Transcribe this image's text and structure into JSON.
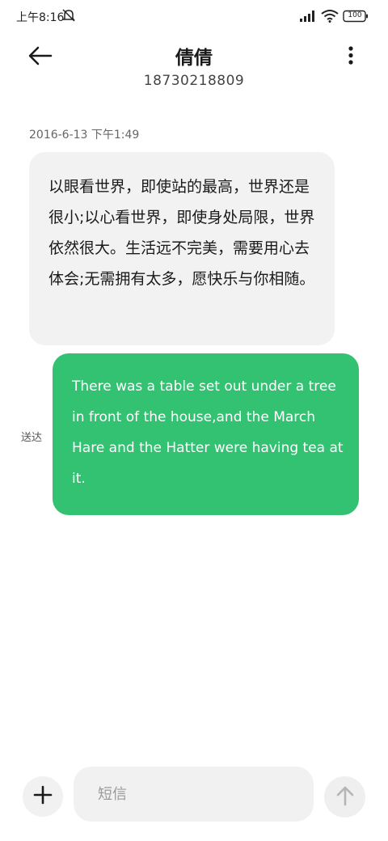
{
  "status_bar": {
    "time": "上午8:16",
    "battery": "100",
    "icons": [
      "do-not-disturb-icon",
      "signal-icon",
      "wifi-icon",
      "battery-icon"
    ]
  },
  "header": {
    "contact_name": "倩倩",
    "contact_number": "18730218809",
    "icons": [
      "back-arrow-icon",
      "more-options-icon"
    ]
  },
  "conversation": {
    "timestamp": "2016-6-13 下午1:49",
    "messages": [
      {
        "direction": "incoming",
        "text": "以眼看世界，即使站的最高，世界还是很小;以心看世界，即使身处局限，世界依然很大。生活远不完美，需要用心去体会;无需拥有太多，愿快乐与你相随。"
      },
      {
        "direction": "outgoing",
        "text": "There was a table set out under a tree in front of the house,and the March Hare and the Hatter were having tea at it.",
        "status": "送达"
      }
    ]
  },
  "composer": {
    "placeholder": "短信",
    "value": "",
    "icons": [
      "plus-icon",
      "send-arrow-icon"
    ]
  },
  "colors": {
    "outgoing_bubble": "#33c172",
    "incoming_bubble": "#f2f2f2",
    "background": "#ffffff"
  }
}
